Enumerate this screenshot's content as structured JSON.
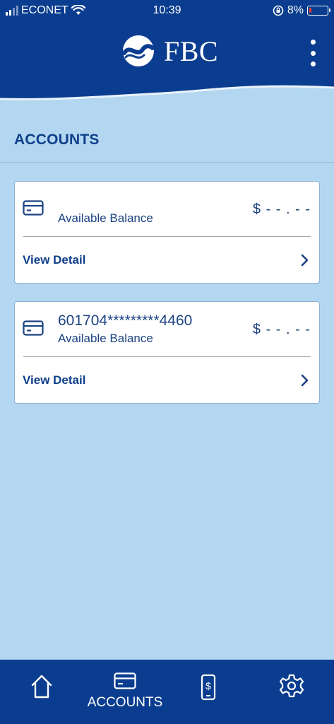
{
  "status_bar": {
    "carrier": "ECONET",
    "time": "10:39",
    "battery_percent": "8%"
  },
  "header": {
    "brand_name": "FBC"
  },
  "section": {
    "title": "ACCOUNTS"
  },
  "accounts": [
    {
      "number": "",
      "label": "Available Balance",
      "balance": "$ - - . - -",
      "detail_label": "View Detail"
    },
    {
      "number": "601704*********4460",
      "label": "Available Balance",
      "balance": "$ - - . - -",
      "detail_label": "View Detail"
    }
  ],
  "bottom_nav": {
    "items": [
      {
        "icon": "home-icon",
        "label": ""
      },
      {
        "icon": "card-icon",
        "label": "ACCOUNTS"
      },
      {
        "icon": "phone-dollar-icon",
        "label": ""
      },
      {
        "icon": "gear-icon",
        "label": ""
      }
    ],
    "active": "ACCOUNTS"
  },
  "colors": {
    "brand_blue": "#0a3d8f",
    "background": "#b3d7f0",
    "text_blue": "#1b4282",
    "battery_low": "#e53935"
  }
}
